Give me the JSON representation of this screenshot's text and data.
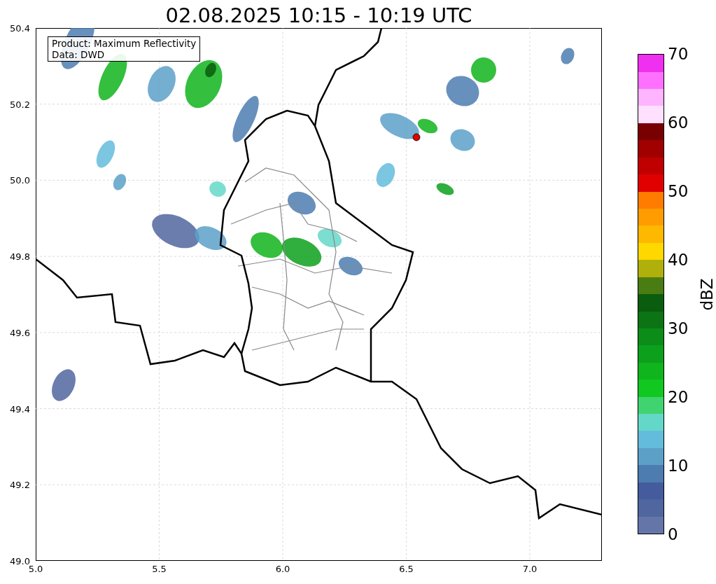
{
  "title": "02.08.2025 10:15 - 10:19 UTC",
  "legend": {
    "lines": [
      "Product: Maximum Reflectivity",
      "Data: DWD"
    ]
  },
  "axes": {
    "yticks": [
      "50.4",
      "50.2",
      "50.0",
      "49.8",
      "49.6",
      "49.4",
      "49.2",
      "49.0"
    ],
    "xticks": [
      "5.0",
      "5.5",
      "6.0",
      "6.5",
      "7.0"
    ]
  },
  "colorbar": {
    "label": "dBZ",
    "ticks": [
      "70",
      "60",
      "50",
      "40",
      "30",
      "20",
      "10",
      "0"
    ],
    "segments": [
      {
        "color": "#6476a8"
      },
      {
        "color": "#50669e"
      },
      {
        "color": "#445c9e"
      },
      {
        "color": "#4c7cb0"
      },
      {
        "color": "#5ca0c8"
      },
      {
        "color": "#64bcdc"
      },
      {
        "color": "#64d8c8"
      },
      {
        "color": "#40d470"
      },
      {
        "color": "#10c820"
      },
      {
        "color": "#10b41c"
      },
      {
        "color": "#0ca01c"
      },
      {
        "color": "#0c8c18"
      },
      {
        "color": "#0c7414"
      },
      {
        "color": "#0a5c0e"
      },
      {
        "color": "#4a7c14"
      },
      {
        "color": "#b0b00c"
      },
      {
        "color": "#ffd800"
      },
      {
        "color": "#ffb800"
      },
      {
        "color": "#ff9c00"
      },
      {
        "color": "#ff7c00"
      },
      {
        "color": "#e00000"
      },
      {
        "color": "#c00000"
      },
      {
        "color": "#a00000"
      },
      {
        "color": "#780000"
      },
      {
        "color": "#ffe0ff"
      },
      {
        "color": "#ffb4ff"
      },
      {
        "color": "#ff70ff"
      },
      {
        "color": "#f030f0"
      }
    ]
  }
}
